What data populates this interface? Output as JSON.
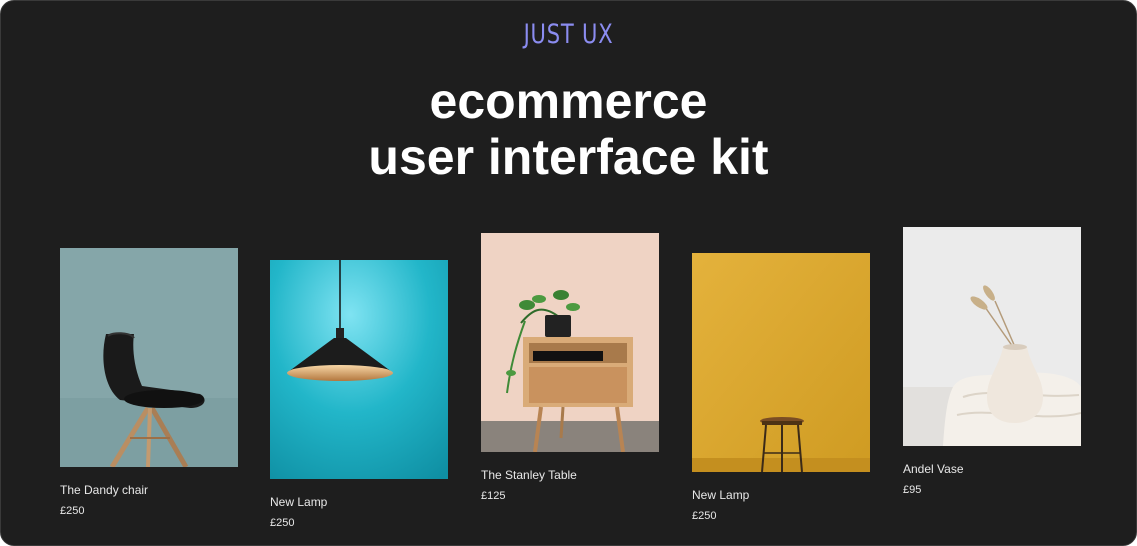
{
  "brand": {
    "logo_text": "JUST UX",
    "color": "#8b8cf0"
  },
  "hero": {
    "title_line1": "ecommerce",
    "title_line2": "user interface kit"
  },
  "products": [
    {
      "name": "The Dandy chair",
      "price": "£250",
      "image_icon": "chair-photo",
      "bg": "#85a6a9"
    },
    {
      "name": "New Lamp",
      "price": "£250",
      "image_icon": "pendant-lamp-photo",
      "bg": "#2fb5c6"
    },
    {
      "name": "The Stanley Table",
      "price": "£125",
      "image_icon": "side-table-photo",
      "bg": "#efd3c4"
    },
    {
      "name": "New Lamp",
      "price": "£250",
      "image_icon": "stool-photo",
      "bg": "#dba932"
    },
    {
      "name": "Andel Vase",
      "price": "£95",
      "image_icon": "vase-photo",
      "bg": "#ebebeb"
    }
  ]
}
